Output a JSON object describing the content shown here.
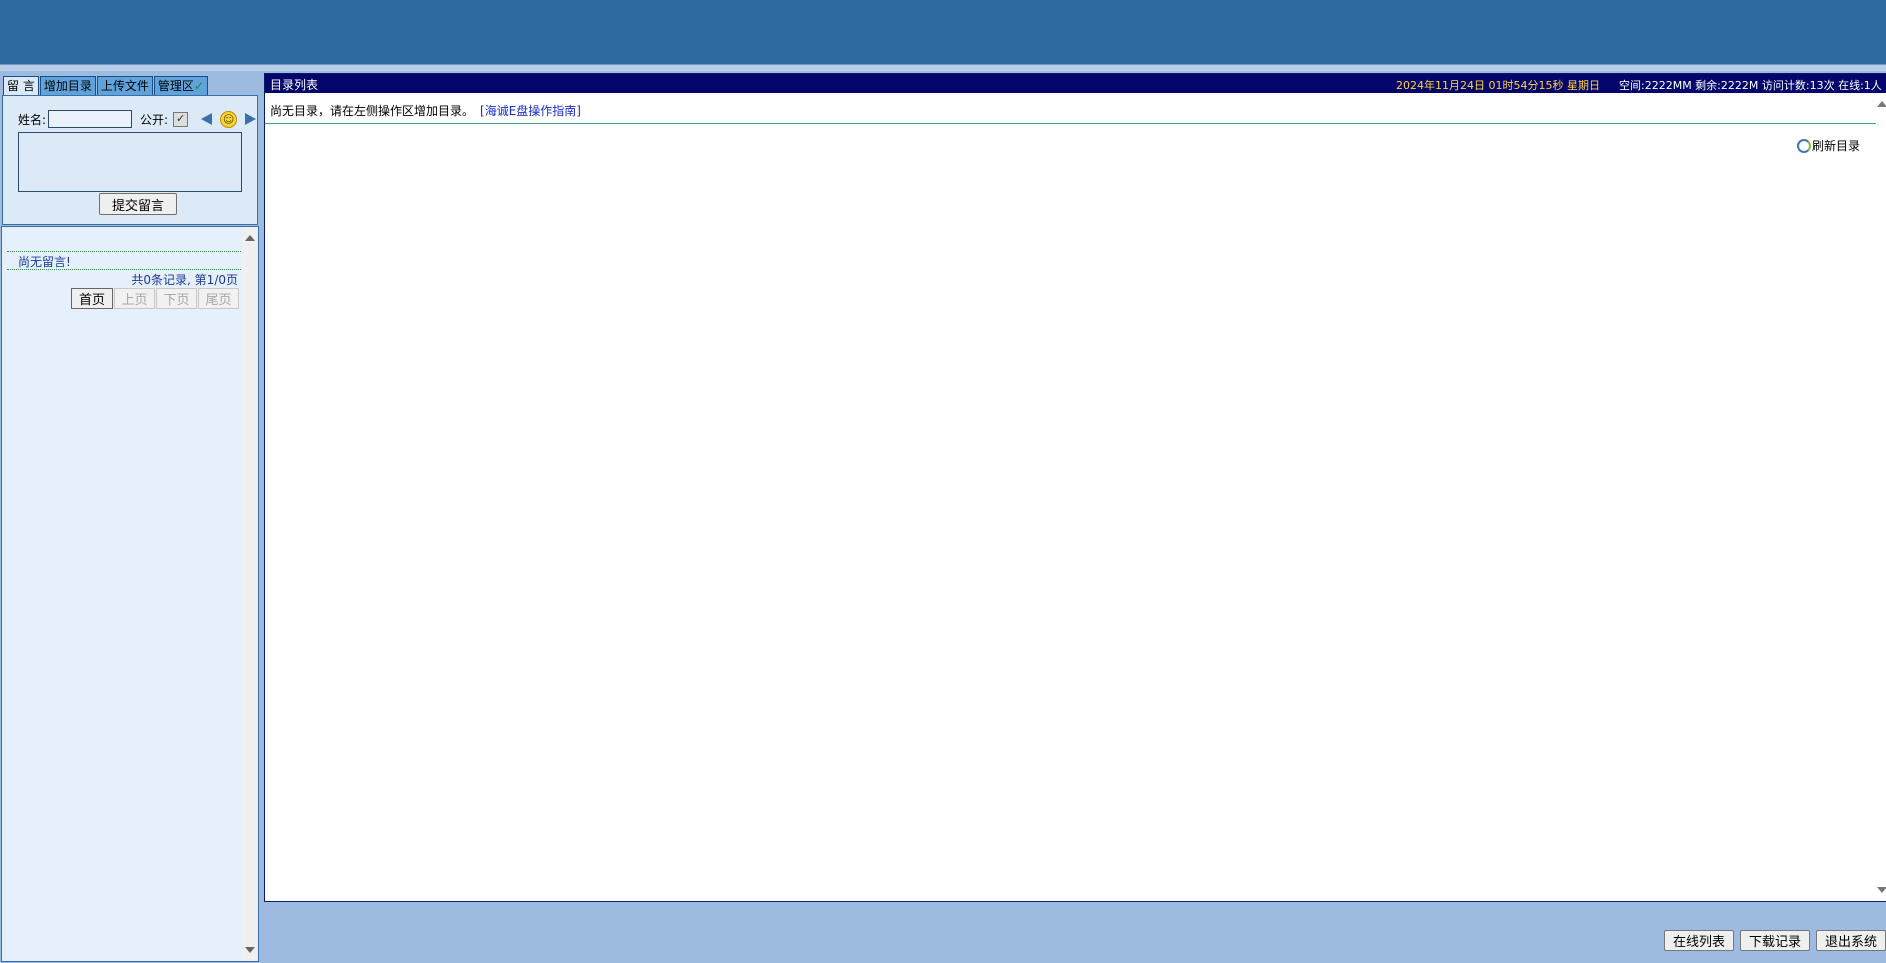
{
  "left": {
    "tabs": [
      {
        "label": "留 言"
      },
      {
        "label": "增加目录"
      },
      {
        "label": "上传文件"
      },
      {
        "label": "管理区",
        "mark": "✓"
      }
    ],
    "form": {
      "name_label": "姓名:",
      "name_value": "",
      "public_label": "公开:",
      "public_checked": true,
      "message_value": "",
      "submit_label": "提交留言"
    },
    "messages": {
      "empty_text": "尚无留言!",
      "record_info": "共0条记录, 第1/0页",
      "pager": [
        "首页",
        "上页",
        "下页",
        "尾页"
      ]
    }
  },
  "main": {
    "title": "目录列表",
    "datetime": "2024年11月24日 01时54分15秒 星期日",
    "stats": "空间:2222MM 剩余:2222M 访问计数:13次 在线:1人",
    "notice": "尚无目录，请在左侧操作区增加目录。",
    "guide_link": "[海诚E盘操作指南]",
    "refresh_label": "刷新目录"
  },
  "bottom_buttons": [
    "在线列表",
    "下载记录",
    "退出系统"
  ],
  "colors": {
    "banner": "#2e6aa0",
    "title_bar": "#05066b",
    "datetime_text": "#ffd63a",
    "link": "#1a2ccc",
    "panel_bg": "#dce9f7"
  }
}
